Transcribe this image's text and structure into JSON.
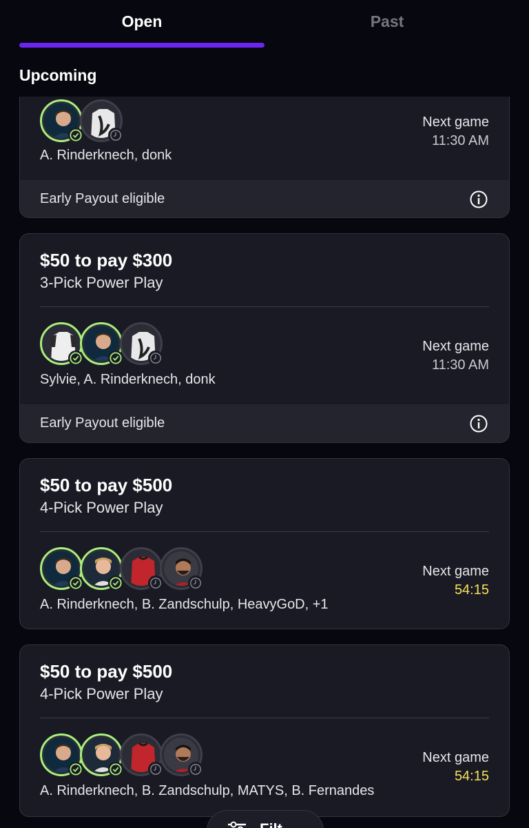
{
  "tabs": [
    {
      "label": "Open",
      "active": true
    },
    {
      "label": "Past",
      "active": false
    }
  ],
  "section_title": "Upcoming",
  "accent_color": "#6b25f0",
  "won_color": "#a8f07c",
  "live_time_color": "#f5e35a",
  "cards": [
    {
      "title": "",
      "subtitle": "",
      "avatars": [
        {
          "kind": "player-photo",
          "status": "won"
        },
        {
          "kind": "jersey-white-black",
          "status": "pending"
        }
      ],
      "pick_names": "A. Rinderknech, donk",
      "next_game_label": "Next game",
      "next_game_time": "11:30 AM",
      "payout_text": "Early Payout eligible"
    },
    {
      "title": "$50 to pay $300",
      "subtitle": "3-Pick Power Play",
      "avatars": [
        {
          "kind": "jersey-white",
          "status": "won"
        },
        {
          "kind": "player-photo",
          "status": "won"
        },
        {
          "kind": "jersey-white-black",
          "status": "pending"
        }
      ],
      "pick_names": "Sylvie, A. Rinderknech, donk",
      "next_game_label": "Next game",
      "next_game_time": "11:30 AM",
      "payout_text": "Early Payout eligible"
    },
    {
      "title": "$50 to pay $500",
      "subtitle": "4-Pick Power Play",
      "avatars": [
        {
          "kind": "player-photo",
          "status": "won"
        },
        {
          "kind": "player-photo-blond",
          "status": "won"
        },
        {
          "kind": "jersey-red",
          "status": "pending"
        },
        {
          "kind": "player-photo-beard",
          "status": "pending"
        }
      ],
      "pick_names": "A. Rinderknech, B. Zandschulp, HeavyGoD, +1",
      "next_game_label": "Next game",
      "next_game_time": "54:15"
    },
    {
      "title": "$50 to pay $500",
      "subtitle": "4-Pick Power Play",
      "avatars": [
        {
          "kind": "player-photo",
          "status": "won"
        },
        {
          "kind": "player-photo-blond",
          "status": "won"
        },
        {
          "kind": "jersey-red",
          "status": "pending"
        },
        {
          "kind": "player-photo-beard",
          "status": "pending"
        }
      ],
      "pick_names": "A. Rinderknech, B. Zandschulp, MATYS, B. Fernandes",
      "next_game_label": "Next game",
      "next_game_time": "54:15"
    }
  ],
  "filter_button": {
    "label": "Filt",
    "icon": "filter-icon"
  }
}
